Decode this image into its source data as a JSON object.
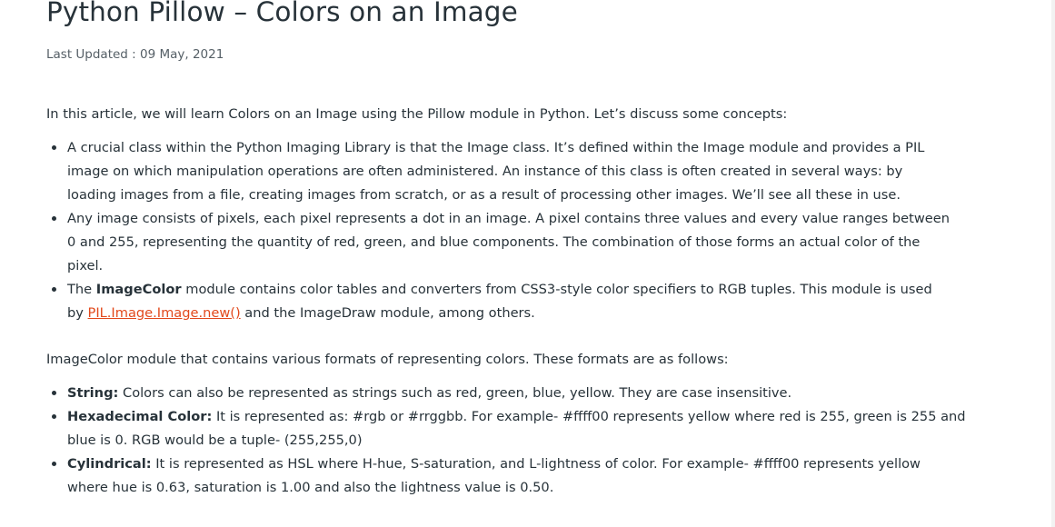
{
  "article": {
    "title": "Python Pillow – Colors on an Image",
    "last_updated": "Last Updated : 09 May, 2021",
    "intro": "In this article, we will learn Colors on an Image using the Pillow module in Python. Let’s discuss some concepts:",
    "concepts": [
      {
        "lines": [
          "A crucial class within the Python Imaging Library is that the Image class. It’s defined within the Image module and provides a PIL",
          "image on which manipulation operations are often administered. An instance of this class is often created in several ways: by",
          "loading images from a file, creating images from scratch, or as a result of processing other images. We’ll see all these in use."
        ]
      },
      {
        "lines": [
          "Any image consists of pixels, each pixel represents a dot in an image. A pixel contains three values and every value ranges between",
          "0 and 255, representing the quantity of red, green, and blue components. The combination of those forms an actual color of the",
          "pixel."
        ]
      },
      {
        "prefix": "The ",
        "bold": "ImageColor",
        "line1_rest": " module contains color tables and converters from CSS3-style color specifiers to RGB tuples. This module is used",
        "line2_prefix": "by ",
        "link_text": "PIL.Image.Image.new()",
        "line2_rest": " and the ImageDraw module, among others."
      }
    ],
    "formats_intro": "ImageColor module that contains various formats of representing colors. These formats are as follows:",
    "formats": [
      {
        "term": "String:",
        "lines": [
          " Colors can also be represented as strings such as red, green, blue, yellow. They are case insensitive."
        ]
      },
      {
        "term": "Hexadecimal Color:",
        "lines": [
          " It is represented as: #rgb or #rrggbb. For example- #ffff00 represents yellow where red is 255, green is 255 and",
          "blue is 0. RGB would be a tuple- (255,255,0)"
        ]
      },
      {
        "term": "Cylindrical:",
        "lines": [
          " It is represented as HSL where H-hue, S-saturation, and L-lightness of color. For example- #ffff00 represents yellow",
          "where hue is 0.63, saturation is 1.00 and also the lightness value is 0.50."
        ]
      }
    ]
  },
  "colors": {
    "text": "#273239",
    "meta": "#555f66",
    "link": "#e2491c",
    "border": "#f2f2f2"
  }
}
